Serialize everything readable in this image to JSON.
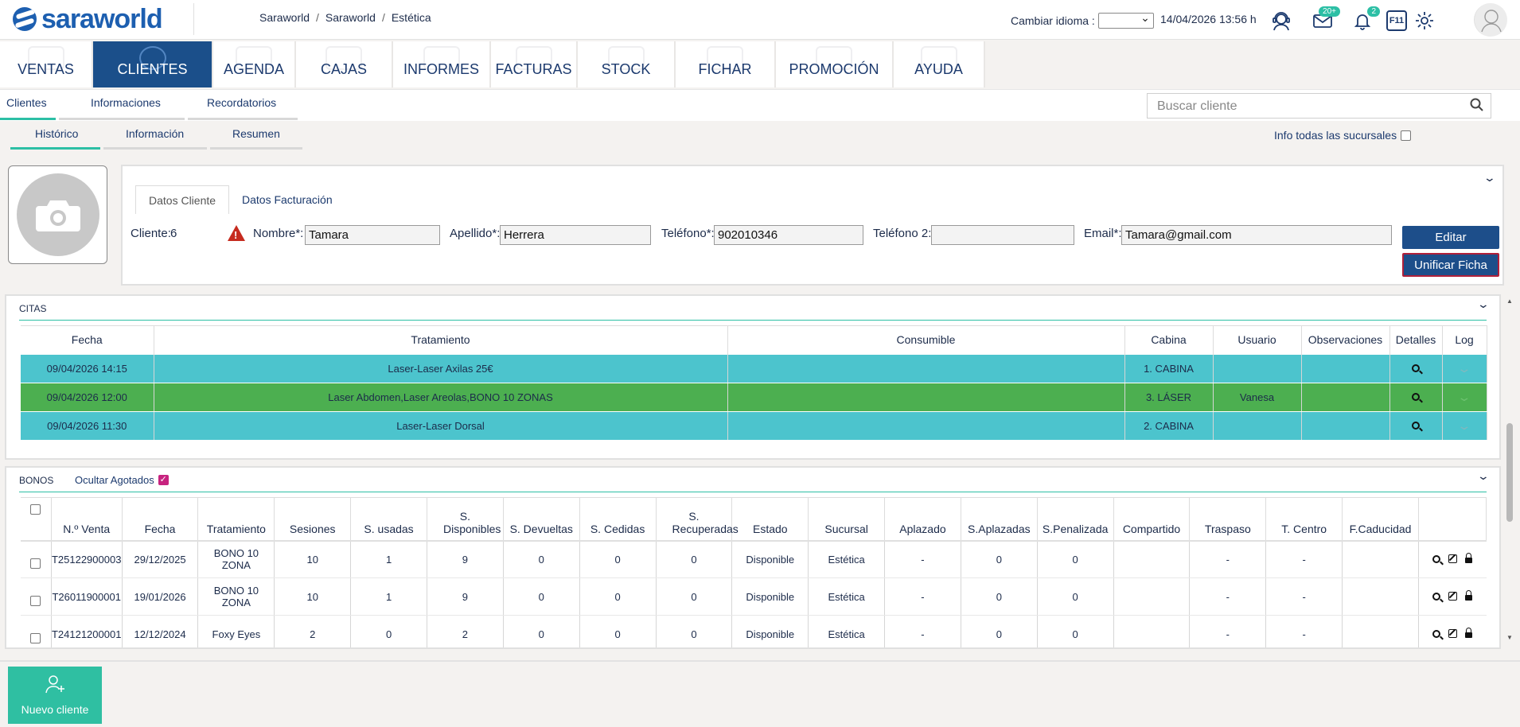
{
  "brand": {
    "name": "saraworld"
  },
  "breadcrumb": [
    "Saraworld",
    "Saraworld",
    "Estética"
  ],
  "header": {
    "language_label": "Cambiar idioma :",
    "language_value": "",
    "datetime": "14/04/2026 13:56 h",
    "mail_badge": "20+",
    "bell_badge": "2",
    "f11_label": "F11"
  },
  "nav": [
    {
      "label": "VENTAS",
      "active": false
    },
    {
      "label": "CLIENTES",
      "active": true
    },
    {
      "label": "AGENDA",
      "active": false
    },
    {
      "label": "CAJAS",
      "active": false
    },
    {
      "label": "INFORMES",
      "active": false
    },
    {
      "label": "FACTURAS",
      "active": false
    },
    {
      "label": "STOCK",
      "active": false
    },
    {
      "label": "FICHAR",
      "active": false
    },
    {
      "label": "PROMOCIÓN",
      "active": false
    },
    {
      "label": "AYUDA",
      "active": false
    }
  ],
  "subnav": {
    "tabs": [
      "Clientes",
      "Informaciones",
      "Recordatorios"
    ],
    "search_placeholder": "Buscar cliente"
  },
  "history_tabs": [
    "Histórico",
    "Información",
    "Resumen"
  ],
  "all_branches_label": "Info todas las sucursales",
  "client": {
    "tabs": [
      "Datos Cliente",
      "Datos Facturación"
    ],
    "id_label": "Cliente:",
    "id_value": "6",
    "name_label": "Nombre*:",
    "name_value": "Tamara",
    "surname_label": "Apellido*:",
    "surname_value": "Herrera",
    "phone_label": "Teléfono*:",
    "phone_value": "902010346",
    "phone2_label": "Teléfono 2:",
    "phone2_value": "",
    "email_label": "Email*:",
    "email_value": "Tamara@gmail.com",
    "edit_button": "Editar",
    "unify_button": "Unificar Ficha"
  },
  "citas": {
    "title": "CITAS",
    "columns": [
      "Fecha",
      "Tratamiento",
      "Consumible",
      "Cabina",
      "Usuario",
      "Observaciones",
      "Detalles",
      "Log"
    ],
    "rows": [
      {
        "fecha": "09/04/2026 14:15",
        "tratamiento": "Laser-Laser Axilas 25€",
        "consumible": "",
        "cabina": "1. CABINA",
        "usuario": "",
        "observaciones": "",
        "color": "#4cc4cd"
      },
      {
        "fecha": "09/04/2026 12:00",
        "tratamiento": "Laser Abdomen,Laser Areolas,BONO 10 ZONAS",
        "consumible": "",
        "cabina": "3. LÁSER",
        "usuario": "Vanesa",
        "observaciones": "",
        "color": "#4caf50"
      },
      {
        "fecha": "09/04/2026 11:30",
        "tratamiento": "Laser-Laser Dorsal",
        "consumible": "",
        "cabina": "2. CABINA",
        "usuario": "",
        "observaciones": "",
        "color": "#4cc4cd"
      }
    ]
  },
  "bonos": {
    "title": "BONOS",
    "hide_label": "Ocultar Agotados",
    "hide_checked": true,
    "columns": [
      "N.º Venta",
      "Fecha",
      "Tratamiento",
      "Sesiones",
      "S. usadas",
      "S. Disponibles",
      "S. Devueltas",
      "S. Cedidas",
      "S. Recuperadas",
      "Estado",
      "Sucursal",
      "Aplazado",
      "S.Aplazadas",
      "S.Penalizada",
      "Compartido",
      "Traspaso",
      "T. Centro",
      "F.Caducidad"
    ],
    "rows": [
      {
        "venta": "T25122900003",
        "fecha": "29/12/2025",
        "tratamiento": "BONO 10 ZONA",
        "sesiones": "10",
        "usadas": "1",
        "disponibles": "9",
        "devueltas": "0",
        "cedidas": "0",
        "recuperadas": "0",
        "estado": "Disponible",
        "sucursal": "Estética",
        "aplazado": "-",
        "aplazadas": "0",
        "penalizada": "0",
        "compartido": "",
        "traspaso": "-",
        "centro": "-",
        "caducidad": ""
      },
      {
        "venta": "T26011900001",
        "fecha": "19/01/2026",
        "tratamiento": "BONO 10 ZONA",
        "sesiones": "10",
        "usadas": "1",
        "disponibles": "9",
        "devueltas": "0",
        "cedidas": "0",
        "recuperadas": "0",
        "estado": "Disponible",
        "sucursal": "Estética",
        "aplazado": "-",
        "aplazadas": "0",
        "penalizada": "0",
        "compartido": "",
        "traspaso": "-",
        "centro": "-",
        "caducidad": ""
      },
      {
        "venta": "T24121200001",
        "fecha": "12/12/2024",
        "tratamiento": "Foxy Eyes",
        "sesiones": "2",
        "usadas": "0",
        "disponibles": "2",
        "devueltas": "0",
        "cedidas": "0",
        "recuperadas": "0",
        "estado": "Disponible",
        "sucursal": "Estética",
        "aplazado": "-",
        "aplazadas": "0",
        "penalizada": "0",
        "compartido": "",
        "traspaso": "-",
        "centro": "-",
        "caducidad": ""
      }
    ]
  },
  "footer": {
    "new_client_button": "Nuevo cliente"
  },
  "colors": {
    "accent": "#2cbfa5",
    "primary": "#1b4f8a",
    "cyan_row": "#4cc4cd",
    "green_row": "#4caf50"
  }
}
